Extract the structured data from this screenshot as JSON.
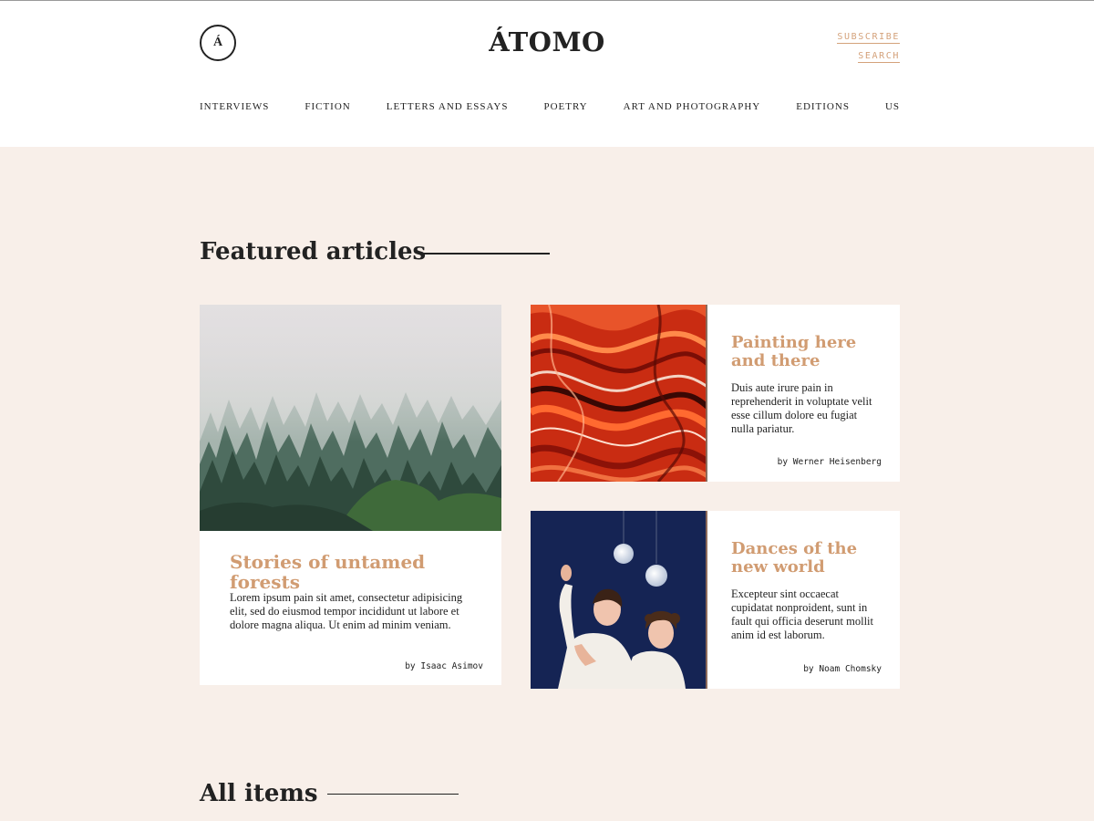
{
  "header": {
    "logo_mark": "Á",
    "brand": "ÁTOMO",
    "links": {
      "subscribe": "SUBSCRIBE",
      "search": "SEARCH"
    }
  },
  "nav": {
    "items": [
      "INTERVIEWS",
      "FICTION",
      "LETTERS AND ESSAYS",
      "POETRY",
      "ART AND PHOTOGRAPHY",
      "EDITIONS",
      "US"
    ]
  },
  "featured": {
    "title": "Featured articles",
    "articles": [
      {
        "image": "misty-forest-image",
        "title": "Stories of untamed forests",
        "excerpt": "Lorem ipsum pain sit amet, consectetur adipisicing elit, sed do eiusmod tempor incididunt ut labore et dolore magna aliqua. Ut enim ad minim veniam.",
        "author": "by Isaac Asimov"
      },
      {
        "image": "red-marble-image",
        "title": "Painting here and there",
        "excerpt": "Duis aute irure pain in reprehenderit in voluptate velit esse cillum dolore eu fugiat nulla pariatur.",
        "author": "by Werner Heisenberg"
      },
      {
        "image": "dancers-image",
        "title": "Dances of the new world",
        "excerpt": "Excepteur sint occaecat cupidatat nonproident, sunt in fault qui officia deserunt mollit anim id est laborum.",
        "author": "by Noam Chomsky"
      }
    ]
  },
  "all_items": {
    "title": "All items"
  },
  "colors": {
    "page_background": "#f8efe9",
    "accent": "#d19c72",
    "text": "#222222",
    "card_background": "#ffffff"
  }
}
